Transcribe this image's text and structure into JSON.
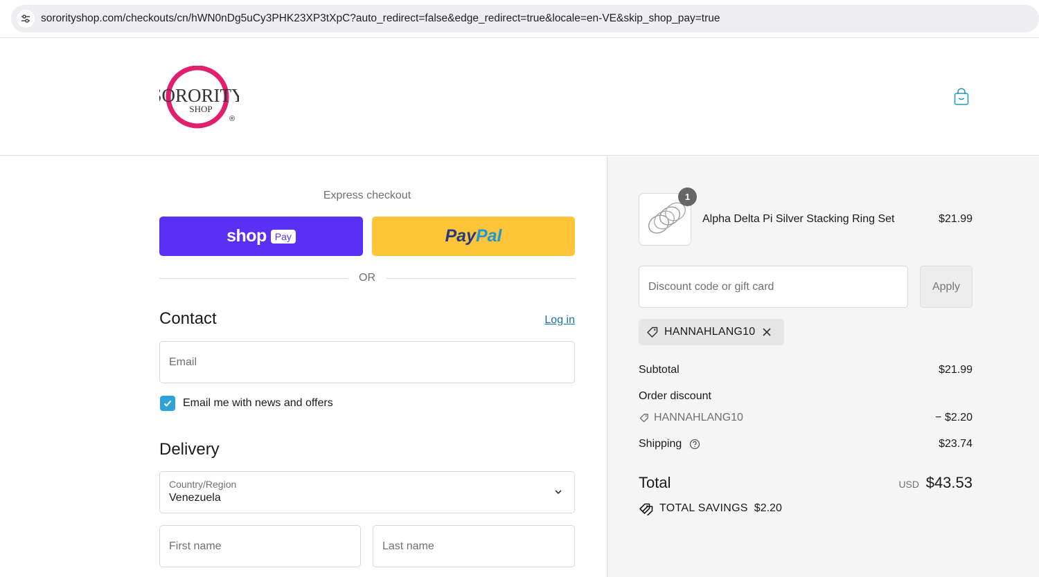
{
  "browser": {
    "url": "sororityshop.com/checkouts/cn/hWN0nDg5uCy3PHK23XP3tXpC?auto_redirect=false&edge_redirect=true&locale=en-VE&skip_shop_pay=true"
  },
  "header": {
    "logo_top": "SORORITY",
    "logo_bottom": "SHOP",
    "logo_mark": "®"
  },
  "express": {
    "title": "Express checkout",
    "shoppay_word": "shop",
    "shoppay_badge": "Pay",
    "paypal_part1": "Pay",
    "paypal_part2": "Pal",
    "or_label": "OR"
  },
  "contact": {
    "title": "Contact",
    "login_label": "Log in",
    "email_placeholder": "Email",
    "newsletter_label": "Email me with news and offers",
    "newsletter_checked": true
  },
  "delivery": {
    "title": "Delivery",
    "country_label": "Country/Region",
    "country_value": "Venezuela",
    "first_name_placeholder": "First name",
    "last_name_placeholder": "Last name"
  },
  "summary": {
    "product_name": "Alpha Delta Pi Silver Stacking Ring Set",
    "product_price": "$21.99",
    "product_qty": "1",
    "discount_placeholder": "Discount code or gift card",
    "apply_label": "Apply",
    "applied_code": "HANNAHLANG10",
    "subtotal_label": "Subtotal",
    "subtotal_value": "$21.99",
    "order_discount_label": "Order discount",
    "discount_code": "HANNAHLANG10",
    "discount_value": "− $2.20",
    "shipping_label": "Shipping",
    "shipping_value": "$23.74",
    "total_label": "Total",
    "total_currency": "USD",
    "total_value": "$43.53",
    "savings_label": "TOTAL SAVINGS",
    "savings_value": "$2.20"
  },
  "colors": {
    "shoppay": "#5a31f4",
    "paypal": "#ffc439",
    "link": "#1773b0",
    "checkbox": "#2da3d8",
    "logo_pink": "#e0206f"
  },
  "icons": [
    "tune-icon",
    "shopping-bag-icon",
    "checkmark-icon",
    "chevron-down-icon",
    "tag-icon",
    "close-icon",
    "help-circle-icon",
    "savings-tag-icon"
  ]
}
